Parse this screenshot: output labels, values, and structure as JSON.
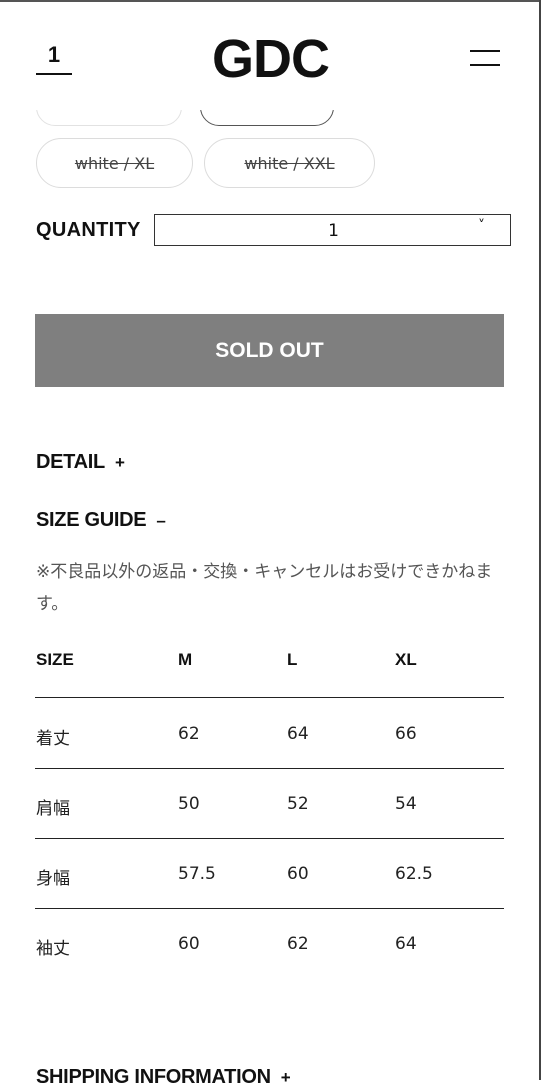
{
  "header": {
    "cart_count": "1",
    "logo": "GDC"
  },
  "size_options": [
    {
      "label": "white / XL",
      "available": false
    },
    {
      "label": "white / XXL",
      "available": false
    }
  ],
  "quantity": {
    "label": "QUANTITY",
    "value": "1",
    "chevron": "˅"
  },
  "buy_button": {
    "label": "SOLD OUT"
  },
  "accordions": {
    "detail": {
      "label": "DETAIL",
      "sign": "+"
    },
    "size_guide": {
      "label": "SIZE GUIDE",
      "sign": "–"
    },
    "shipping": {
      "label": "SHIPPING INFORMATION",
      "sign": "+"
    }
  },
  "size_guide": {
    "note": "※不良品以外の返品・交換・キャンセルはお受けできかねます。",
    "headers": [
      "SIZE",
      "M",
      "L",
      "XL"
    ],
    "rows": [
      [
        "着丈",
        "62",
        "64",
        "66"
      ],
      [
        "肩幅",
        "50",
        "52",
        "54"
      ],
      [
        "身幅",
        "57.5",
        "60",
        "62.5"
      ],
      [
        "袖丈",
        "60",
        "62",
        "64"
      ]
    ]
  },
  "icons": {
    "menu": "hamburger-menu-icon",
    "select": "chevron-down-icon"
  },
  "colors": {
    "sold_out_bg": "#7f7f7f",
    "text": "#111111",
    "border": "#dcdcdc"
  }
}
